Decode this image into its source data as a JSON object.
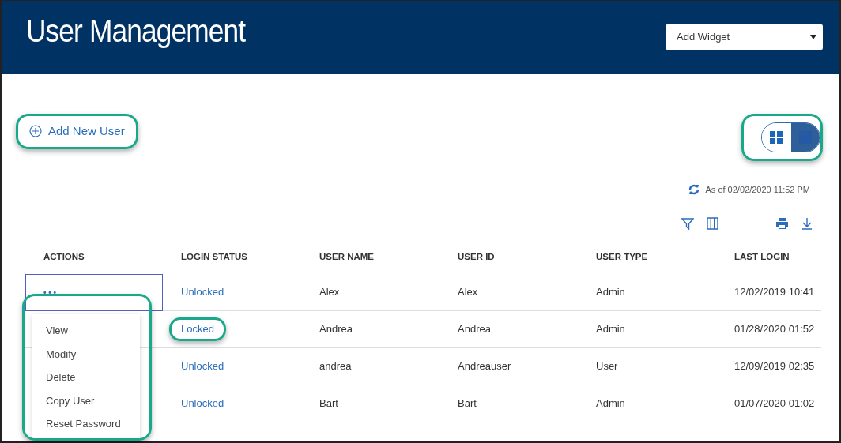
{
  "header": {
    "title": "User Management",
    "widget_select": {
      "value": "Add Widget"
    }
  },
  "add_user": {
    "label": "Add New User",
    "highlighted": true
  },
  "view_toggle": {
    "highlighted": true,
    "options": [
      {
        "kind": "grid",
        "selected": false
      },
      {
        "kind": "table",
        "selected": true
      }
    ]
  },
  "timestamp": "As of 02/02/2020 11:52 PM",
  "table": {
    "columns": [
      "ACTIONS",
      "LOGIN STATUS",
      "USER NAME",
      "USER ID",
      "USER TYPE",
      "LAST LOGIN"
    ],
    "rows": [
      {
        "actions": "• • •",
        "login_status": "Unlocked",
        "status_highlighted": false,
        "user_name": "Alex",
        "user_id": "Alex",
        "user_type": "Admin",
        "last_login": "12/02/2019 10:41"
      },
      {
        "login_status": "Locked",
        "status_highlighted": true,
        "user_name": "Andrea",
        "user_id": "Andrea",
        "user_type": "Admin",
        "last_login": "01/28/2020 01:52"
      },
      {
        "login_status": "Unlocked",
        "status_highlighted": false,
        "user_name": "andrea",
        "user_id": "Andreauser",
        "user_type": "User",
        "last_login": "12/09/2019 02:35"
      },
      {
        "login_status": "Unlocked",
        "status_highlighted": false,
        "user_name": "Bart",
        "user_id": "Bart",
        "user_type": "Admin",
        "last_login": "01/07/2020 01:02"
      }
    ]
  },
  "action_menu": {
    "highlighted": true,
    "items": [
      "View",
      "Modify",
      "Delete",
      "Copy User",
      "Reset Password"
    ]
  }
}
